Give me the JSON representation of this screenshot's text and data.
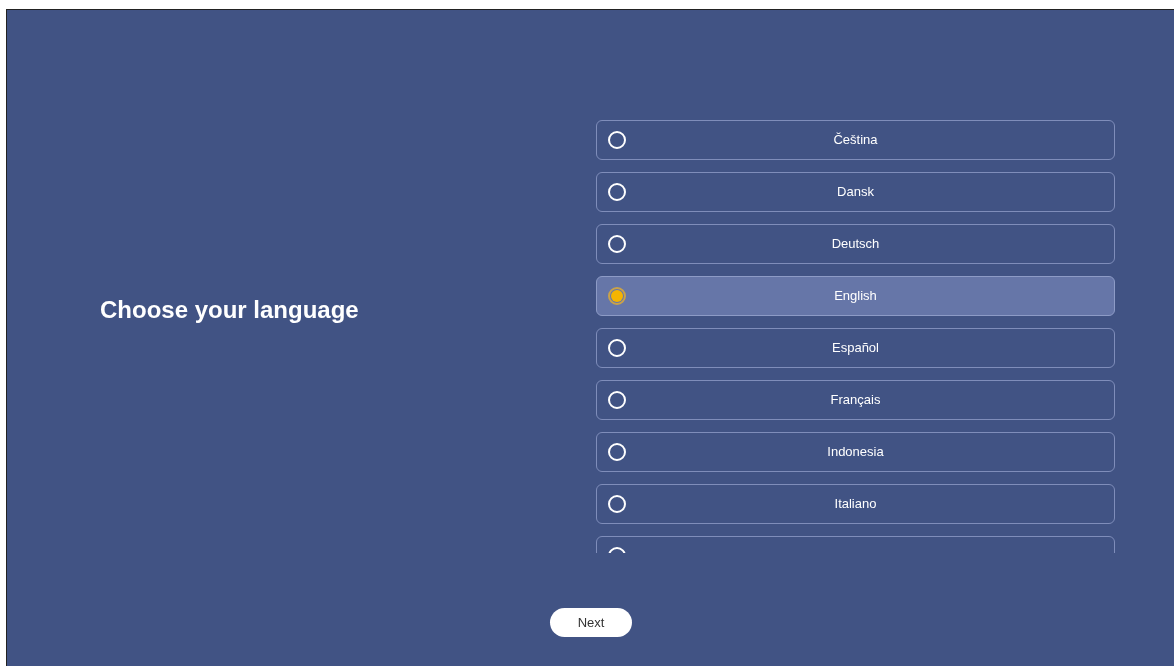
{
  "title": "Choose your language",
  "languages": [
    {
      "label": "Čeština",
      "selected": false
    },
    {
      "label": "Dansk",
      "selected": false
    },
    {
      "label": "Deutsch",
      "selected": false
    },
    {
      "label": "English",
      "selected": true
    },
    {
      "label": "Español",
      "selected": false
    },
    {
      "label": "Français",
      "selected": false
    },
    {
      "label": "Indonesia",
      "selected": false
    },
    {
      "label": "Italiano",
      "selected": false
    },
    {
      "selected": false
    }
  ],
  "next_button": "Next"
}
